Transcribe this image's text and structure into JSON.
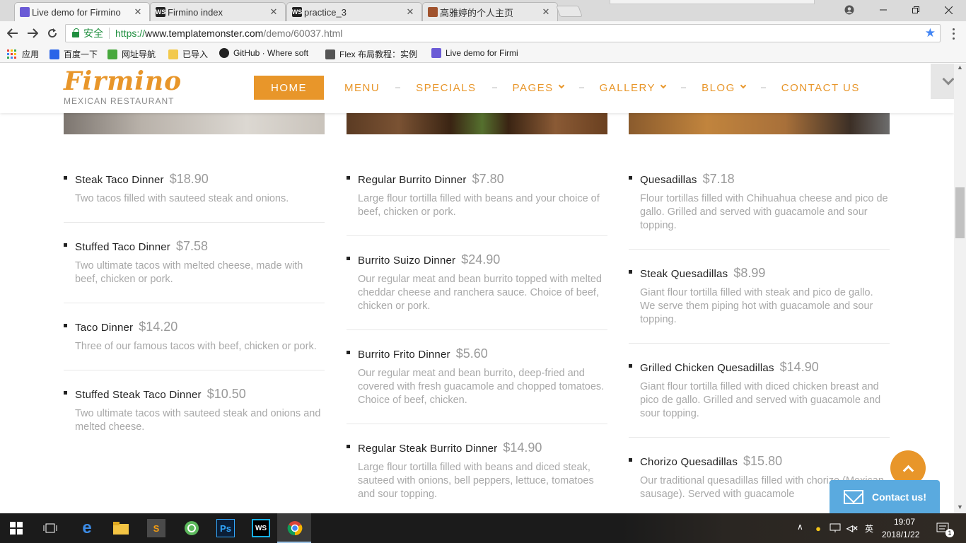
{
  "browser": {
    "tabs": [
      {
        "title": "Live demo for Firmino",
        "favicon": "templatemonster-icon",
        "color": "#6b5bd6"
      },
      {
        "title": "Firmino index",
        "favicon": "webstorm-icon",
        "color": "#222222"
      },
      {
        "title": "practice_3",
        "favicon": "webstorm-icon",
        "color": "#222222"
      },
      {
        "title": "高雅婷的个人主页",
        "favicon": "home-icon",
        "color": "#a0522d"
      }
    ],
    "security_label": "安全",
    "url_scheme": "https://",
    "url_host": "www.templatemonster.com",
    "url_path": "/demo/60037.html",
    "bookmarks": [
      {
        "label": "应用",
        "icon": "apps-grid-icon"
      },
      {
        "label": "百度一下",
        "icon": "baidu-icon"
      },
      {
        "label": "网址导航",
        "icon": "hao123-icon"
      },
      {
        "label": "已导入",
        "icon": "folder-icon"
      },
      {
        "label": "GitHub · Where soft",
        "icon": "github-icon"
      },
      {
        "label": "Flex 布局教程：实例",
        "icon": "ruanyifeng-icon"
      },
      {
        "label": "Live demo for Firmi",
        "icon": "templatemonster-icon"
      }
    ]
  },
  "site": {
    "logo": "Firmino",
    "tagline": "MEXICAN RESTAURANT",
    "brand_color": "#e8962a",
    "nav": [
      {
        "label": "HOME",
        "active": true,
        "dropdown": false
      },
      {
        "label": "MENU",
        "active": false,
        "dropdown": false
      },
      {
        "label": "SPECIALS",
        "active": false,
        "dropdown": false
      },
      {
        "label": "PAGES",
        "active": false,
        "dropdown": true
      },
      {
        "label": "GALLERY",
        "active": false,
        "dropdown": true
      },
      {
        "label": "BLOG",
        "active": false,
        "dropdown": true
      },
      {
        "label": "CONTACT US",
        "active": false,
        "dropdown": false
      }
    ],
    "columns": [
      [
        {
          "name": "Steak Taco Dinner",
          "price": "$18.90",
          "desc": "Two tacos filled with sauteed steak and onions."
        },
        {
          "name": "Stuffed Taco Dinner",
          "price": "$7.58",
          "desc": "Two ultimate tacos with melted cheese, made with beef, chicken or pork."
        },
        {
          "name": "Taco Dinner",
          "price": "$14.20",
          "desc": "Three of our famous tacos with beef, chicken or pork."
        },
        {
          "name": "Stuffed Steak Taco Dinner",
          "price": "$10.50",
          "desc": "Two ultimate tacos with sauteed steak and onions and melted cheese."
        }
      ],
      [
        {
          "name": "Regular Burrito Dinner",
          "price": "$7.80",
          "desc": "Large flour tortilla filled with beans and your choice of beef, chicken or pork."
        },
        {
          "name": "Burrito Suizo Dinner",
          "price": "$24.90",
          "desc": "Our regular meat and bean burrito topped with melted cheddar cheese and ranchera sauce. Choice of beef, chicken or pork."
        },
        {
          "name": "Burrito Frito Dinner",
          "price": "$5.60",
          "desc": "Our regular meat and bean burrito, deep-fried and covered with fresh guacamole and chopped tomatoes. Choice of beef, chicken."
        },
        {
          "name": "Regular Steak Burrito Dinner",
          "price": "$14.90",
          "desc": "Large flour tortilla filled with beans and diced steak, sauteed with onions, bell peppers, lettuce, tomatoes and sour topping."
        }
      ],
      [
        {
          "name": "Quesadillas",
          "price": "$7.18",
          "desc": "Flour tortillas filled with Chihuahua cheese and pico de gallo. Grilled and served with guacamole and sour topping."
        },
        {
          "name": "Steak Quesadillas",
          "price": "$8.99",
          "desc": "Giant flour tortilla filled with steak and pico de gallo. We serve them piping hot with guacamole and sour topping."
        },
        {
          "name": "Grilled Chicken Quesadillas",
          "price": "$14.90",
          "desc": "Giant flour tortilla filled with diced chicken breast and pico de gallo. Grilled and served with guacamole and sour topping."
        },
        {
          "name": "Chorizo Quesadillas",
          "price": "$15.80",
          "desc": "Our traditional quesadillas filled with chorizo (Mexican sausage). Served with guacamole"
        }
      ]
    ],
    "contact_widget": "Contact us!"
  },
  "taskbar": {
    "time": "19:07",
    "date": "2018/1/22",
    "ime": "英",
    "notification_count": "1"
  }
}
